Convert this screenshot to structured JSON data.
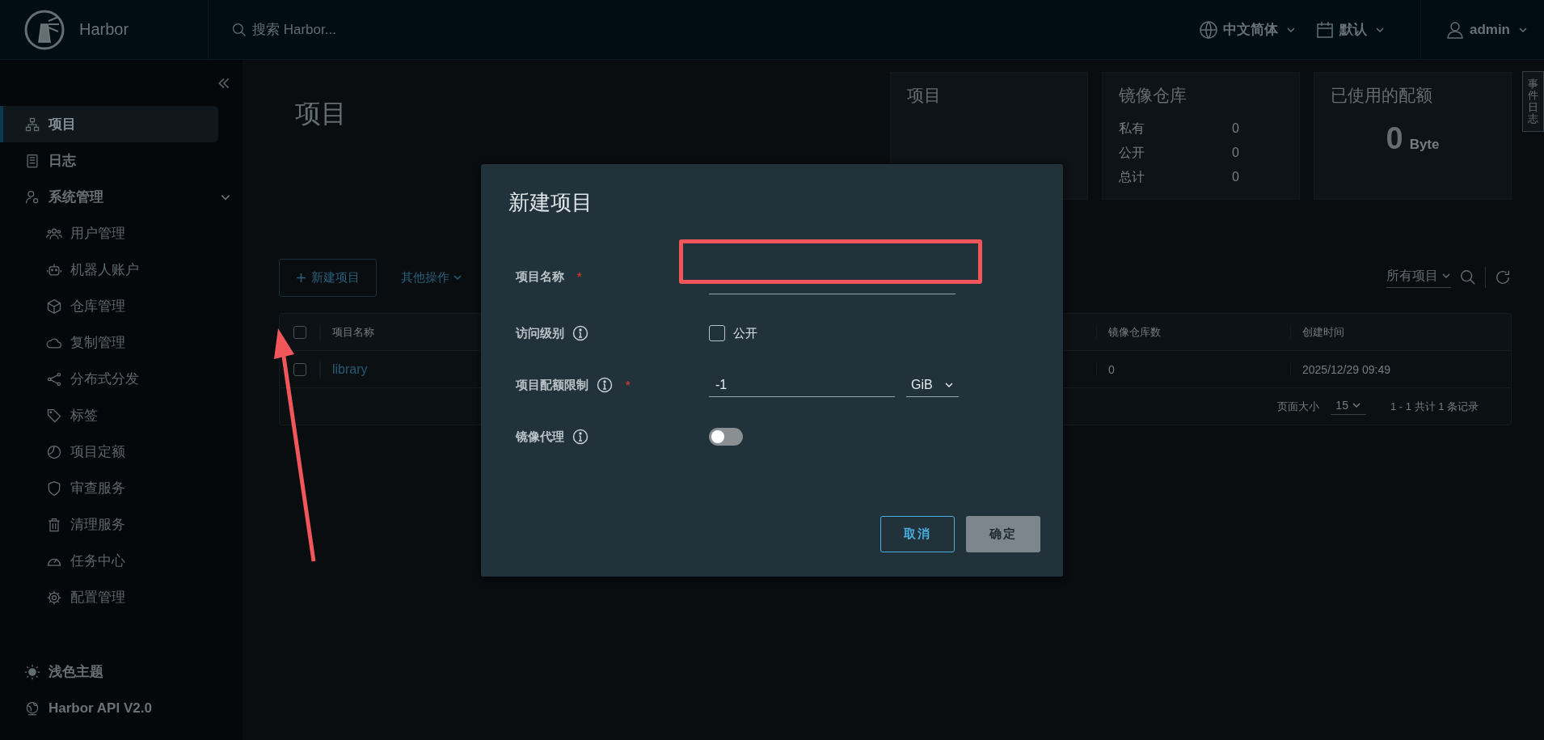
{
  "topbar": {
    "brand": "Harbor",
    "search_placeholder": "搜索 Harbor...",
    "language": "中文简体",
    "appearance": "默认",
    "user": "admin"
  },
  "sidebar": {
    "items": [
      {
        "label": "项目",
        "selected": true
      },
      {
        "label": "日志",
        "selected": false
      },
      {
        "label": "系统管理",
        "selected": false,
        "expanded": true,
        "children": [
          {
            "label": "用户管理",
            "selected": false
          },
          {
            "label": "机器人账户",
            "selected": false
          },
          {
            "label": "仓库管理",
            "selected": false
          },
          {
            "label": "复制管理",
            "selected": false
          },
          {
            "label": "分布式分发",
            "selected": false
          },
          {
            "label": "标签",
            "selected": false
          },
          {
            "label": "项目定额",
            "selected": false
          },
          {
            "label": "审查服务",
            "selected": false
          },
          {
            "label": "清理服务",
            "selected": false
          },
          {
            "label": "任务中心",
            "selected": false
          },
          {
            "label": "配置管理",
            "selected": false
          }
        ]
      }
    ],
    "footer": [
      {
        "label": "浅色主题"
      },
      {
        "label": "Harbor API V2.0"
      }
    ]
  },
  "side_tab": "事件日志",
  "page_title": "项目",
  "stats": [
    {
      "kind": "list",
      "title": "项目"
    },
    {
      "kind": "list",
      "title": "镜像仓库",
      "rows": [
        {
          "label": "私有",
          "value": "0"
        },
        {
          "label": "公开",
          "value": "0"
        },
        {
          "label": "总计",
          "value": "0"
        }
      ]
    },
    {
      "kind": "amount",
      "title": "已使用的配额",
      "amount": "0",
      "unit": "Byte"
    }
  ],
  "toolbar": {
    "new_button": "新建项目",
    "more_menu": "其他操作",
    "filter": "所有项目"
  },
  "table": {
    "all_selected": false,
    "columns": [
      "项目名称",
      "镜像仓库数",
      "创建时间"
    ],
    "rows": [
      {
        "selected": false,
        "cells": [
          "library",
          "0",
          "2025/12/29 09:49"
        ]
      }
    ],
    "footer": {
      "page_size_label": "页面大小",
      "page_size": "15",
      "summary": "1 - 1 共计 1 条记录"
    }
  },
  "dialog": {
    "title": "新建项目",
    "fields": [
      {
        "kind": "text",
        "label": "项目名称",
        "required_mark": "*"
      },
      {
        "kind": "checkbox",
        "label": "访问级别",
        "info": true,
        "option": "公开",
        "checked": false
      },
      {
        "kind": "quota",
        "label": "项目配额限制",
        "required_mark": "*",
        "info": true,
        "value": "-1",
        "unit": "GiB"
      },
      {
        "kind": "toggle",
        "label": "镜像代理",
        "info": true,
        "on": false
      }
    ],
    "buttons": [
      {
        "label": "取消",
        "kind": "secondary",
        "disabled": false
      },
      {
        "label": "确定",
        "kind": "primary",
        "disabled": true
      }
    ]
  },
  "annotations": {
    "highlight_frame": true,
    "arrow": true
  }
}
